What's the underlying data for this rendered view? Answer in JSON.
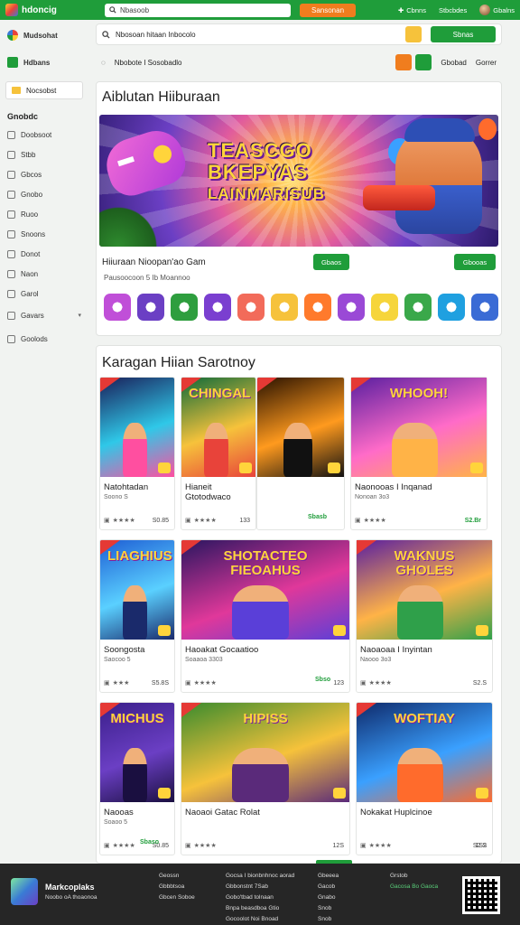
{
  "topbar": {
    "brand": "hdoncig",
    "search_placeholder": "Nbasoob",
    "search_button": "Sansonan",
    "actions": [
      "Cbnns",
      "Stbcbdes",
      "Gbalns"
    ]
  },
  "sidebar": {
    "top_items": [
      "Mudsohat",
      "Hdbans"
    ],
    "pill": "Nocsobst",
    "heading": "Gnobdc",
    "items": [
      "Doobsoot",
      "Stbb",
      "Gbcos",
      "Gnobo",
      "Ruoo",
      "Snoons",
      "Donot",
      "Naon",
      "Garol",
      "Gavars",
      "Goolods"
    ]
  },
  "filter": {
    "search_text": "Nbosoan hitaan Inbocolo",
    "button": "Sbnas",
    "row_text": "Nbobote I Sosobadlo",
    "row_right": [
      "Gbobad",
      "Gorrer"
    ]
  },
  "featured": {
    "section_title": "Aiblutan Hiiburaan",
    "hero_title_lines": [
      "TEASCGO",
      "BKEPYAS",
      "LAINMARISUB"
    ],
    "game_title": "Hiiuraan Nioopan'ao Gam",
    "game_sub": "Pausoocoon 5 Ib Moannoo",
    "btn_small": "Gbaos",
    "btn_wide": "Gbooas",
    "app_icons": [
      "#c04fd8",
      "#6b3fc4",
      "#2e9e3e",
      "#7a3fd0",
      "#f26b5a",
      "#f6c23b",
      "#ff7a2c",
      "#9a49d6",
      "#f6d53b",
      "#3aa84a",
      "#1fa0e0",
      "#3a6bd5",
      "#ff5a3c"
    ]
  },
  "browse": {
    "section_title": "Karagan Hiian Sarotnoy",
    "tiles": [
      {
        "title": "Natohtadan",
        "sub": "Soono S",
        "rating": "★★★★",
        "price": "S0.85",
        "green": false,
        "logo": ""
      },
      {
        "title": "Hianeit Gtotodwaco",
        "sub": "",
        "rating": "★★★★",
        "price": "133",
        "green": false,
        "logo": "CHINGAL"
      },
      {
        "title": "",
        "sub": "",
        "rating": "",
        "price": "",
        "green": false,
        "logo": ""
      },
      {
        "title": "Naonooas I Inqanad",
        "sub": "Nonoan 3o3",
        "rating": "★★★★",
        "price": "S2.Br",
        "green": true,
        "logo": "WHOOH!",
        "price_left": "Sbasb"
      },
      {
        "title": "Soongosta",
        "sub": "Saocoo 5",
        "rating": "★★★",
        "price": "S5.8S",
        "green": false,
        "logo": "LIAGHIUS"
      },
      {
        "title": "Haoakat Gocaatioo",
        "sub": "Soaaoa 3303",
        "rating": "★★★★",
        "price": "123",
        "green": false,
        "logo": "SHOTACTEO FIEOAHUS"
      },
      {
        "title": "Naoaoaa I Inyintan",
        "sub": "Naooo 3o3",
        "rating": "★★★★",
        "price": "S2.S",
        "green": false,
        "logo": "WAKNUS GHOLES",
        "price_left": "Sbso"
      },
      {
        "title": "Naooas",
        "sub": "Soaoo 5",
        "rating": "★★★★",
        "price": "S0.85",
        "green": false,
        "logo": "MICHUS"
      },
      {
        "title": "Naoaoi Gatac Rolat",
        "sub": "",
        "rating": "★★★★",
        "price": "12S",
        "green": false,
        "logo": "HIPISS",
        "price_left": "Sbaso"
      },
      {
        "title": "Nokakat Huplcinoe",
        "sub": "",
        "rating": "★★★★",
        "price": "1S2",
        "green": false,
        "logo": "WOFTIAY",
        "price_right": "S2.S"
      }
    ]
  },
  "footer": {
    "brand": "Markcoplaks",
    "tagline": "Noobo oA thoaonoa",
    "cols": [
      [
        "Geossn",
        "Gbbbtsoa",
        "Gbcen Soboe"
      ],
      [
        "Gocsa I bionbnhnoc aorad",
        "Gbbonstnt 7Sab",
        "Gobo'tbad tolnaan",
        "Bnpa beasdboa Gtio",
        "Gocoolot Noi Bnoad"
      ],
      [
        "Gbeeea",
        "Gacob",
        "Gnabo",
        "Snob",
        "Snob"
      ],
      [
        "Grstob",
        "Gacosa Bo Gaoca"
      ]
    ]
  }
}
